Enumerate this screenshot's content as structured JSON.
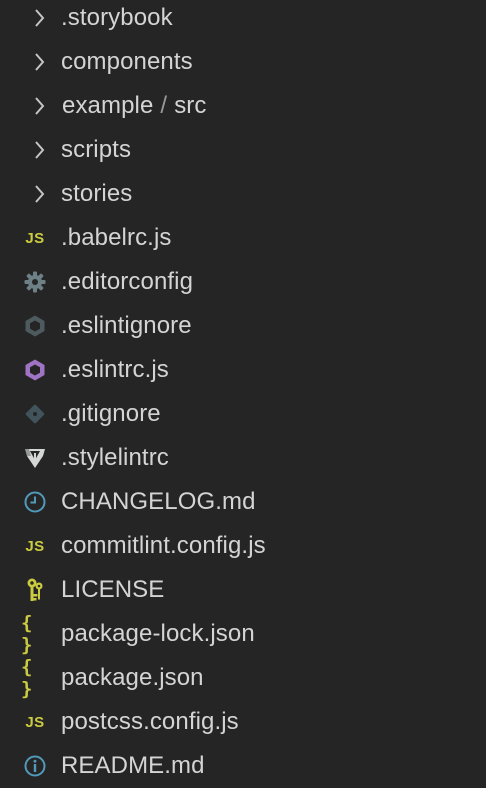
{
  "tree": {
    "folders": [
      {
        "label": ".storybook"
      },
      {
        "label": "components"
      },
      {
        "label": "example",
        "sub": "src"
      },
      {
        "label": "scripts"
      },
      {
        "label": "stories"
      }
    ],
    "files": [
      {
        "label": ".babelrc.js",
        "icon": "javascript-icon",
        "glyph": "JS",
        "color": "#cbcb41"
      },
      {
        "label": ".editorconfig",
        "icon": "gear-icon",
        "color": "#6d8086"
      },
      {
        "label": ".eslintignore",
        "icon": "eslint-hexagon-icon",
        "color": "#4d5a5e"
      },
      {
        "label": ".eslintrc.js",
        "icon": "eslint-hexagon-icon",
        "color": "#a074c4"
      },
      {
        "label": ".gitignore",
        "icon": "git-diamond-icon",
        "color": "#41535b"
      },
      {
        "label": ".stylelintrc",
        "icon": "stylelint-icon",
        "color": "#d4d7d6"
      },
      {
        "label": "CHANGELOG.md",
        "icon": "clock-icon",
        "color": "#519aba"
      },
      {
        "label": "commitlint.config.js",
        "icon": "javascript-icon",
        "glyph": "JS",
        "color": "#cbcb41"
      },
      {
        "label": "LICENSE",
        "icon": "license-key-icon",
        "color": "#cbcb41"
      },
      {
        "label": "package-lock.json",
        "icon": "json-braces-icon",
        "glyph": "{ }",
        "color": "#cbcb41"
      },
      {
        "label": "package.json",
        "icon": "json-braces-icon",
        "glyph": "{ }",
        "color": "#cbcb41"
      },
      {
        "label": "postcss.config.js",
        "icon": "javascript-icon",
        "glyph": "JS",
        "color": "#cbcb41"
      },
      {
        "label": "README.md",
        "icon": "info-icon",
        "color": "#519aba"
      }
    ]
  },
  "colors": {
    "background": "#252526",
    "text": "#d4d4d4",
    "chevron": "#c5c5c5"
  }
}
